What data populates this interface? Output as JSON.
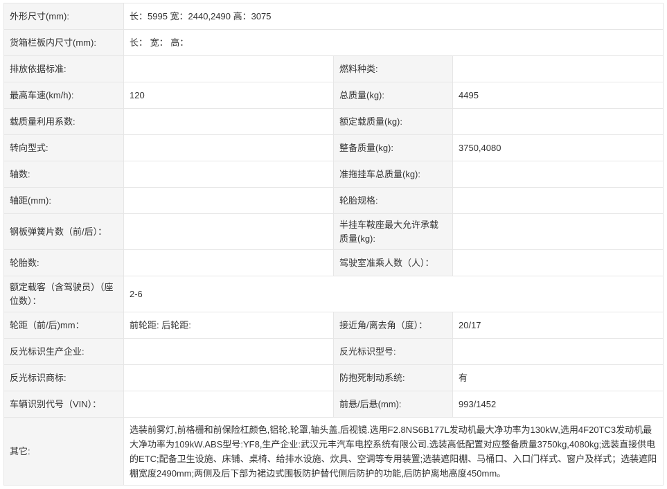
{
  "rows": [
    {
      "type": "wide",
      "label": "外形尺寸(mm):",
      "value": "长：5995 宽：2440,2490 高：3075"
    },
    {
      "type": "wide",
      "label": "货箱栏板内尺寸(mm):",
      "value": "长： 宽： 高："
    },
    {
      "type": "pair",
      "label1": "排放依据标准:",
      "value1": "",
      "label2": "燃料种类:",
      "value2": ""
    },
    {
      "type": "pair",
      "label1": "最高车速(km/h):",
      "value1": "120",
      "label2": "总质量(kg):",
      "value2": "4495"
    },
    {
      "type": "pair",
      "label1": "载质量利用系数:",
      "value1": "",
      "label2": "额定载质量(kg):",
      "value2": ""
    },
    {
      "type": "pair",
      "label1": "转向型式:",
      "value1": "",
      "label2": "整备质量(kg):",
      "value2": "3750,4080"
    },
    {
      "type": "pair",
      "label1": "轴数:",
      "value1": "",
      "label2": "准拖挂车总质量(kg):",
      "value2": ""
    },
    {
      "type": "pair",
      "label1": "轴距(mm):",
      "value1": "",
      "label2": "轮胎规格:",
      "value2": ""
    },
    {
      "type": "pair",
      "label1": "钢板弹簧片数（前/后）：",
      "value1": "",
      "label2": "半挂车鞍座最大允许承载质量(kg):",
      "value2": ""
    },
    {
      "type": "pair",
      "label1": "轮胎数:",
      "value1": "",
      "label2": "驾驶室准乘人数（人）：",
      "value2": ""
    },
    {
      "type": "wide",
      "label": "额定载客（含驾驶员）（座位数）：",
      "value": "2-6"
    },
    {
      "type": "pair",
      "label1": "轮距（前/后)mm：",
      "value1": "前轮距: 后轮距:",
      "label2": "接近角/离去角（度）：",
      "value2": "20/17"
    },
    {
      "type": "pair",
      "label1": "反光标识生产企业:",
      "value1": "",
      "label2": "反光标识型号:",
      "value2": ""
    },
    {
      "type": "pair",
      "label1": "反光标识商标:",
      "value1": "",
      "label2": "防抱死制动系统:",
      "value2": "有"
    },
    {
      "type": "pair",
      "label1": "车辆识别代号（VIN）：",
      "value1": "",
      "label2": "前悬/后悬(mm):",
      "value2": "993/1452"
    },
    {
      "type": "wide",
      "label": "其它:",
      "value": "选装前雾灯,前格栅和前保险杠颜色,铝轮,轮罩,轴头盖,后视镜.选用F2.8NS6B177L发动机最大净功率为130kW,选用4F20TC3发动机最大净功率为109kW.ABS型号:YF8,生产企业:武汉元丰汽车电控系统有限公司.选装高低配置对应整备质量3750kg,4080kg;选装直接供电的ETC;配备卫生设施、床铺、桌椅、给排水设施、炊具、空调等专用装置;选装遮阳棚、马桶口、入口门样式、窗户及样式；选装遮阳棚宽度2490mm;两侧及后下部为裙边式围板防护替代侧后防护的功能,后防护离地高度450mm。"
    }
  ]
}
